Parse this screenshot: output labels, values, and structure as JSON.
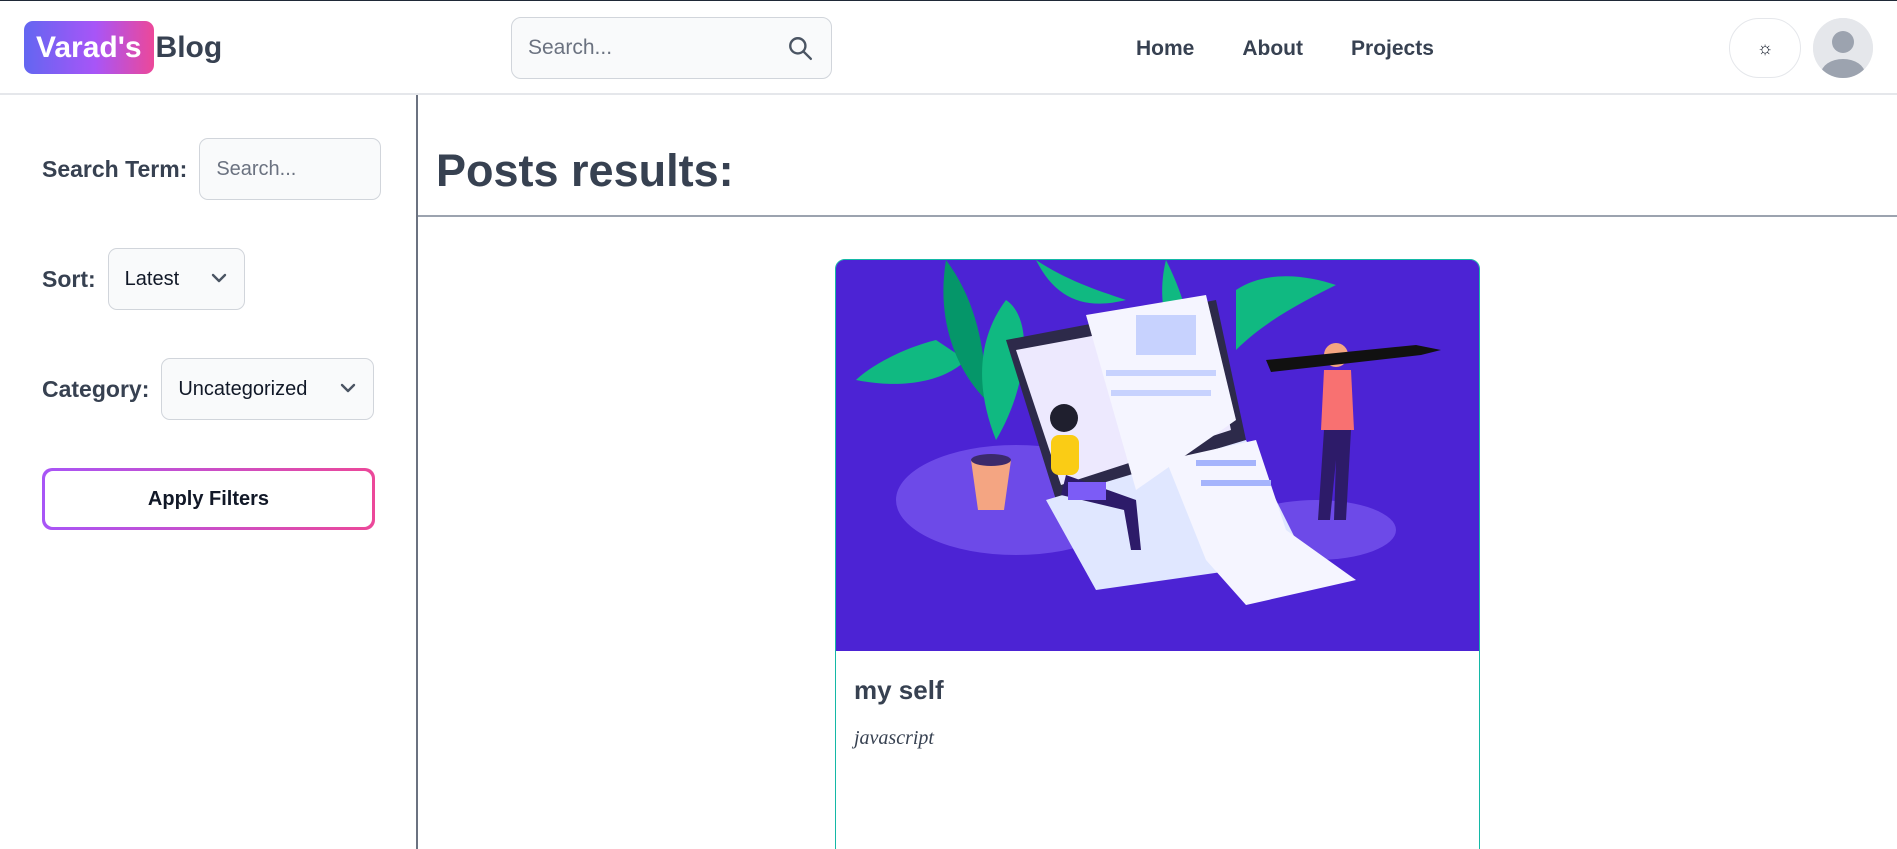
{
  "brand": {
    "badge": "Varad's",
    "rest": "Blog"
  },
  "header_search": {
    "placeholder": "Search..."
  },
  "nav": {
    "home": "Home",
    "about": "About",
    "projects": "Projects"
  },
  "theme_toggle": {
    "glyph": "☼"
  },
  "filters": {
    "search_label": "Search Term:",
    "search_placeholder": "Search...",
    "sort_label": "Sort:",
    "sort_value": "Latest",
    "category_label": "Category:",
    "category_value": "Uncategorized",
    "apply_label": "Apply Filters"
  },
  "main": {
    "title": "Posts results:"
  },
  "posts": [
    {
      "title": "my self",
      "category": "javascript"
    }
  ],
  "colors": {
    "brand_gradient_start": "#6366f1",
    "brand_gradient_end": "#ec4899",
    "card_image_bg": "#4c23d4",
    "card_border": "#14b8a6"
  }
}
